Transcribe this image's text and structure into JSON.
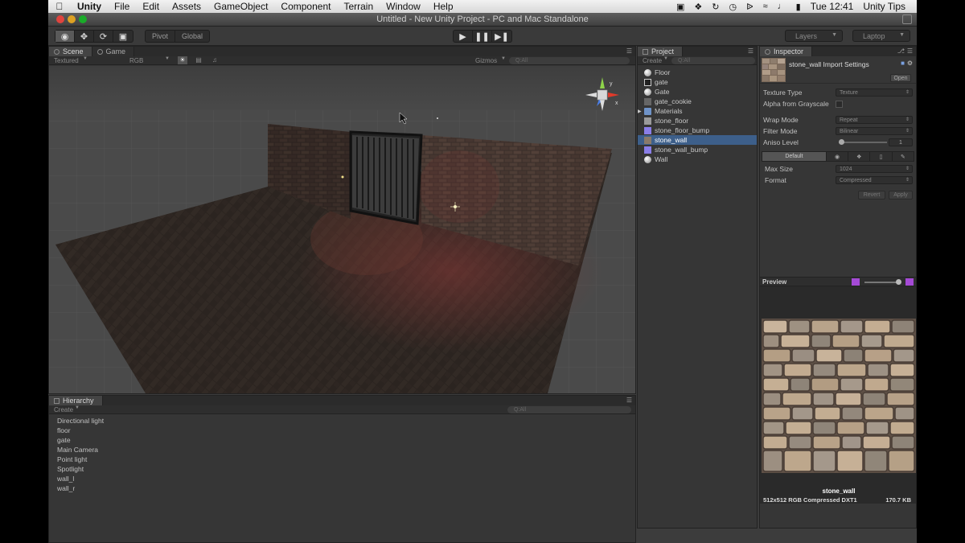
{
  "menubar": {
    "items": [
      "Unity",
      "File",
      "Edit",
      "Assets",
      "GameObject",
      "Component",
      "Terrain",
      "Window",
      "Help"
    ],
    "clock": "Tue 12:41",
    "user": "Unity Tips"
  },
  "window": {
    "title": "Untitled - New Unity Project - PC and Mac Standalone"
  },
  "toolbar": {
    "pivot_label": "Pivot",
    "global_label": "Global",
    "layers_label": "Layers",
    "layout_label": "Laptop"
  },
  "scene": {
    "tab_scene": "Scene",
    "tab_game": "Game",
    "render_mode": "Textured",
    "color_mode": "RGB",
    "gizmos_label": "Gizmos",
    "search_placeholder": "Q:All"
  },
  "hierarchy": {
    "tab": "Hierarchy",
    "create_label": "Create",
    "search_placeholder": "Q:All",
    "items": [
      "Directional light",
      "floor",
      "gate",
      "Main Camera",
      "Point light",
      "Spotlight",
      "wall_l",
      "wall_r"
    ]
  },
  "project": {
    "tab": "Project",
    "create_label": "Create",
    "search_placeholder": "Q:All",
    "items": [
      {
        "label": "Floor",
        "icon": "sphere-icon"
      },
      {
        "label": "gate",
        "icon": "texture-icon"
      },
      {
        "label": "Gate",
        "icon": "sphere-icon"
      },
      {
        "label": "gate_cookie",
        "icon": "texture-icon"
      },
      {
        "label": "Materials",
        "icon": "folder-icon"
      },
      {
        "label": "stone_floor",
        "icon": "texture-icon"
      },
      {
        "label": "stone_floor_bump",
        "icon": "normalmap-icon"
      },
      {
        "label": "stone_wall",
        "icon": "texture-icon"
      },
      {
        "label": "stone_wall_bump",
        "icon": "normalmap-icon"
      },
      {
        "label": "Wall",
        "icon": "sphere-icon"
      }
    ],
    "selected_index": 7
  },
  "inspector": {
    "tab": "Inspector",
    "title": "stone_wall Import Settings",
    "open_label": "Open",
    "texture_type_label": "Texture Type",
    "texture_type_value": "Texture",
    "alpha_label": "Alpha from Grayscale",
    "wrap_label": "Wrap Mode",
    "wrap_value": "Repeat",
    "filter_label": "Filter Mode",
    "filter_value": "Bilinear",
    "aniso_label": "Aniso Level",
    "aniso_value": "1",
    "default_label": "Default",
    "max_size_label": "Max Size",
    "max_size_value": "1024",
    "format_label": "Format",
    "format_value": "Compressed",
    "revert_label": "Revert",
    "apply_label": "Apply"
  },
  "preview": {
    "label": "Preview",
    "name": "stone_wall",
    "dims": "512x512  RGB Compressed DXT1",
    "size": "170.7 KB"
  },
  "colors": {
    "selection": "#3d5f8a",
    "panel_bg": "#363636",
    "axis_x": "#e03a2a",
    "axis_y": "#8ed34a",
    "axis_z": "#4a7ee8"
  }
}
